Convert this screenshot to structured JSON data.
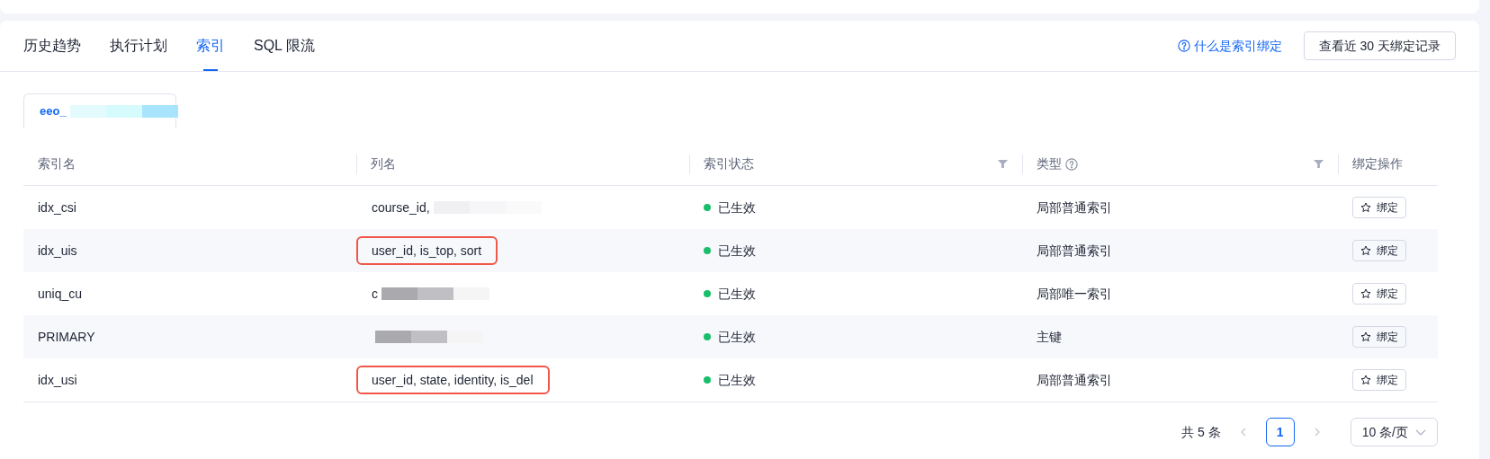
{
  "tabs": [
    {
      "label": "历史趋势",
      "selected": false
    },
    {
      "label": "执行计划",
      "selected": false
    },
    {
      "label": "索引",
      "selected": true
    },
    {
      "label": "SQL 限流",
      "selected": false
    }
  ],
  "help_link": "什么是索引绑定",
  "history_button": "查看近 30 天绑定记录",
  "table_tabs": [
    {
      "label": "eeo_",
      "redacted": true,
      "selected": true
    }
  ],
  "table": {
    "columns": [
      {
        "label": "索引名",
        "kind": "plain"
      },
      {
        "label": "列名",
        "kind": "plain"
      },
      {
        "label": "索引状态",
        "kind": "filter"
      },
      {
        "label": "类型",
        "kind": "help-filter"
      },
      {
        "label": "绑定操作",
        "kind": "plain"
      }
    ],
    "rows": [
      {
        "index_name": "idx_csi",
        "columns_text": "course_id,",
        "redacted": true,
        "highlighted": false,
        "status": {
          "text": "已生效",
          "color": "#19be6b"
        },
        "type": "局部普通索引",
        "action": "绑定"
      },
      {
        "index_name": "idx_uis",
        "columns_text": "user_id, is_top, sort",
        "redacted": false,
        "highlighted": true,
        "status": {
          "text": "已生效",
          "color": "#19be6b"
        },
        "type": "局部普通索引",
        "action": "绑定"
      },
      {
        "index_name": "uniq_cu",
        "columns_text": "c",
        "redacted": true,
        "highlighted": false,
        "status": {
          "text": "已生效",
          "color": "#19be6b"
        },
        "type": "局部唯一索引",
        "action": "绑定"
      },
      {
        "index_name": "PRIMARY",
        "redacted": true,
        "highlighted": false,
        "status": {
          "text": "已生效",
          "color": "#19be6b"
        },
        "type": "主键",
        "action": "绑定"
      },
      {
        "index_name": "idx_usi",
        "columns_text": "user_id, state, identity, is_del",
        "redacted": false,
        "highlighted": true,
        "status": {
          "text": "已生效",
          "color": "#19be6b"
        },
        "type": "局部普通索引",
        "action": "绑定"
      }
    ]
  },
  "pagination": {
    "total": "共 5 条",
    "pages": [
      {
        "label": "1",
        "selected": true
      }
    ],
    "page_size": "10 条/页"
  }
}
